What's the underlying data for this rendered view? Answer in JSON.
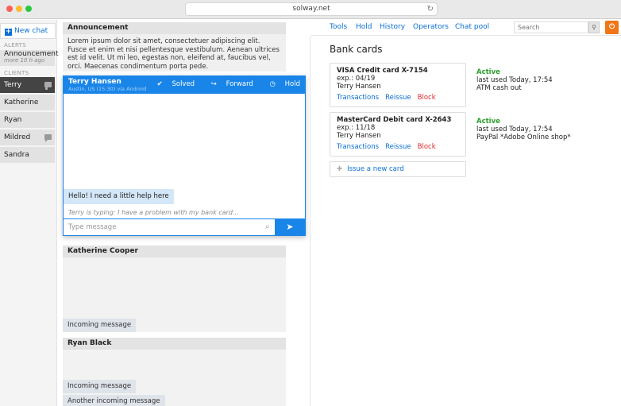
{
  "browser": {
    "url": "solway.net"
  },
  "sidebar": {
    "new_chat": "New chat",
    "alerts_label": "ALERTS",
    "announcement": {
      "label": "Announcement",
      "time": "more 10 h ago"
    },
    "clients_label": "CLIENTS",
    "clients": [
      "Terry",
      "Katherine",
      "Ryan",
      "Mildred",
      "Sandra"
    ]
  },
  "announcement": {
    "title": "Announcement",
    "text": "Lorem ipsum dolor sit amet, consectetuer adipiscing elit. Fusce et enim et nisi pellentesque vestibulum. Aenean ultrices est id velit. Ut mi leo, egestas non, eleifend at, faucibus vel, orci. Maecenas condimentum porta pede."
  },
  "chat": {
    "name": "Terry Hansen",
    "sub": "Austin, US (15:30) via Android",
    "actions": {
      "solved": "Solved",
      "forward": "Forward",
      "hold": "Hold"
    },
    "message": "Hello! I need a little help here",
    "typing": "Terry is typing: I have a problem with my bank card...",
    "input_placeholder": "Type message"
  },
  "clients_panels": [
    {
      "name": "Katherine Cooper",
      "messages": [
        "Incoming message"
      ]
    },
    {
      "name": "Ryan Black",
      "messages": [
        "Incoming message",
        "Another incoming message"
      ]
    }
  ],
  "nav": {
    "items": [
      "Tools",
      "Hold",
      "History",
      "Operators",
      "Chat pool"
    ],
    "search_placeholder": "Search"
  },
  "bank": {
    "title": "Bank cards",
    "cards": [
      {
        "title": "VISA Credit card X-7154",
        "exp": "exp.: 04/19",
        "holder": "Terry Hansen",
        "status": "Active",
        "last_used": "last used Today, 17:54",
        "detail": "ATM cash out"
      },
      {
        "title": "MasterCard Debit card X-2643",
        "exp": "exp.: 11/18",
        "holder": "Terry Hansen",
        "status": "Active",
        "last_used": "last used Today, 17:54",
        "detail": "PayPal *Adobe Online shop*"
      }
    ],
    "links": {
      "transactions": "Transactions",
      "reissue": "Reissue",
      "block": "Block"
    },
    "issue_new": "Issue a new card"
  },
  "colors": {
    "accent": "#1a85e8",
    "link": "#0a6fd6",
    "active": "#2aa12a",
    "block": "#e02a2a",
    "power": "#f07617"
  }
}
